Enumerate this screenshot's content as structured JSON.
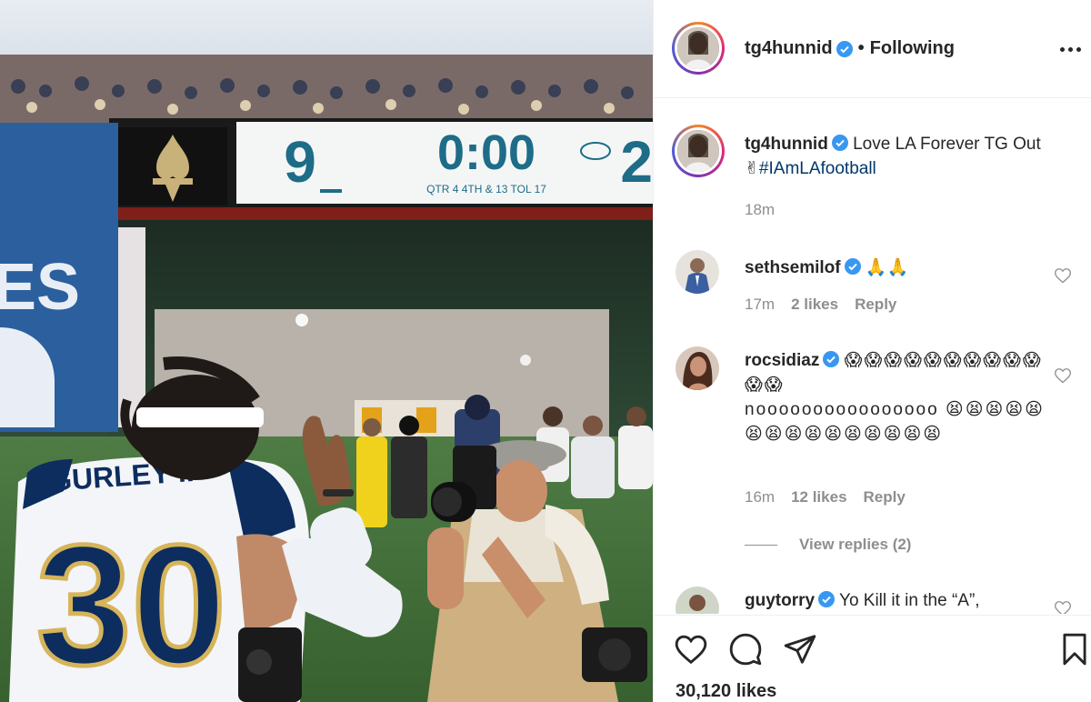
{
  "post": {
    "author": "tg4hunnid",
    "follow_state": "Following",
    "separator": "•",
    "caption_text": "Love LA Forever TG Out",
    "caption_hashtag": "#IAmLAfootball",
    "caption_time": "18m",
    "likes_count": "30,120 likes"
  },
  "photo": {
    "scoreboard_home": "9",
    "scoreboard_clock": "0:00",
    "scoreboard_away": "2",
    "scoreboard_detail": "QTR 4   4TH & 13   TOL 17",
    "banner_text": "ES",
    "jersey_name": "GURLEY II",
    "jersey_number": "30",
    "colors": {
      "rams_navy": "#0c2d5e",
      "rams_gold": "#d6b45a",
      "field_green": "#3f6b3a"
    }
  },
  "comments": [
    {
      "username": "sethsemilof",
      "text": "🙏🙏",
      "time": "17m",
      "likes": "2 likes",
      "reply_label": "Reply"
    },
    {
      "username": "rocsidiaz",
      "text_line1": "😱😱😱😱😱😱😱😱😱😱😱😱",
      "text_line2": "noooooooooooooooo 😫😫😫😫😫😫😫😫😫😫😫😫😫😫😫",
      "time": "16m",
      "likes": "12 likes",
      "reply_label": "Reply",
      "view_replies": "View replies (2)"
    },
    {
      "username": "guytorry",
      "text": "Yo Kill it in the “A”,"
    }
  ],
  "icons": {
    "more": "more-options-icon",
    "verified": "verified-badge-icon",
    "like": "heart-icon",
    "comment": "comment-bubble-icon",
    "share": "paper-plane-icon",
    "save": "bookmark-icon"
  }
}
